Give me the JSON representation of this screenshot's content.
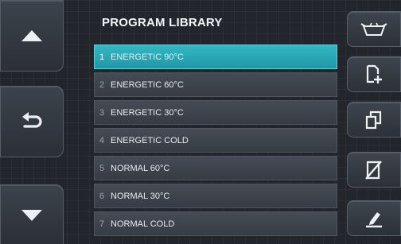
{
  "header": {
    "title": "PROGRAM LIBRARY"
  },
  "programs": [
    {
      "number": "1",
      "name": "ENERGETIC 90°C",
      "selected": true
    },
    {
      "number": "2",
      "name": "ENERGETIC 60°C",
      "selected": false
    },
    {
      "number": "3",
      "name": "ENERGETIC 30°C",
      "selected": false
    },
    {
      "number": "4",
      "name": "ENERGETIC COLD",
      "selected": false
    },
    {
      "number": "5",
      "name": "NORMAL 60°C",
      "selected": false
    },
    {
      "number": "6",
      "name": "NORMAL 30°C",
      "selected": false
    },
    {
      "number": "7",
      "name": "NORMAL COLD",
      "selected": false
    }
  ],
  "navigation": {
    "up_icon": "arrow-up-icon",
    "back_icon": "return-arrow-icon",
    "down_icon": "arrow-down-icon"
  },
  "actions": {
    "load_icon": "washing-basket-icon",
    "new_icon": "add-document-icon",
    "copy_icon": "copy-icon",
    "delete_icon": "delete-document-icon",
    "edit_icon": "edit-pencil-icon"
  },
  "colors": {
    "selected": "#1f98a6",
    "background": "#22262c",
    "text": "#e8ebee"
  }
}
